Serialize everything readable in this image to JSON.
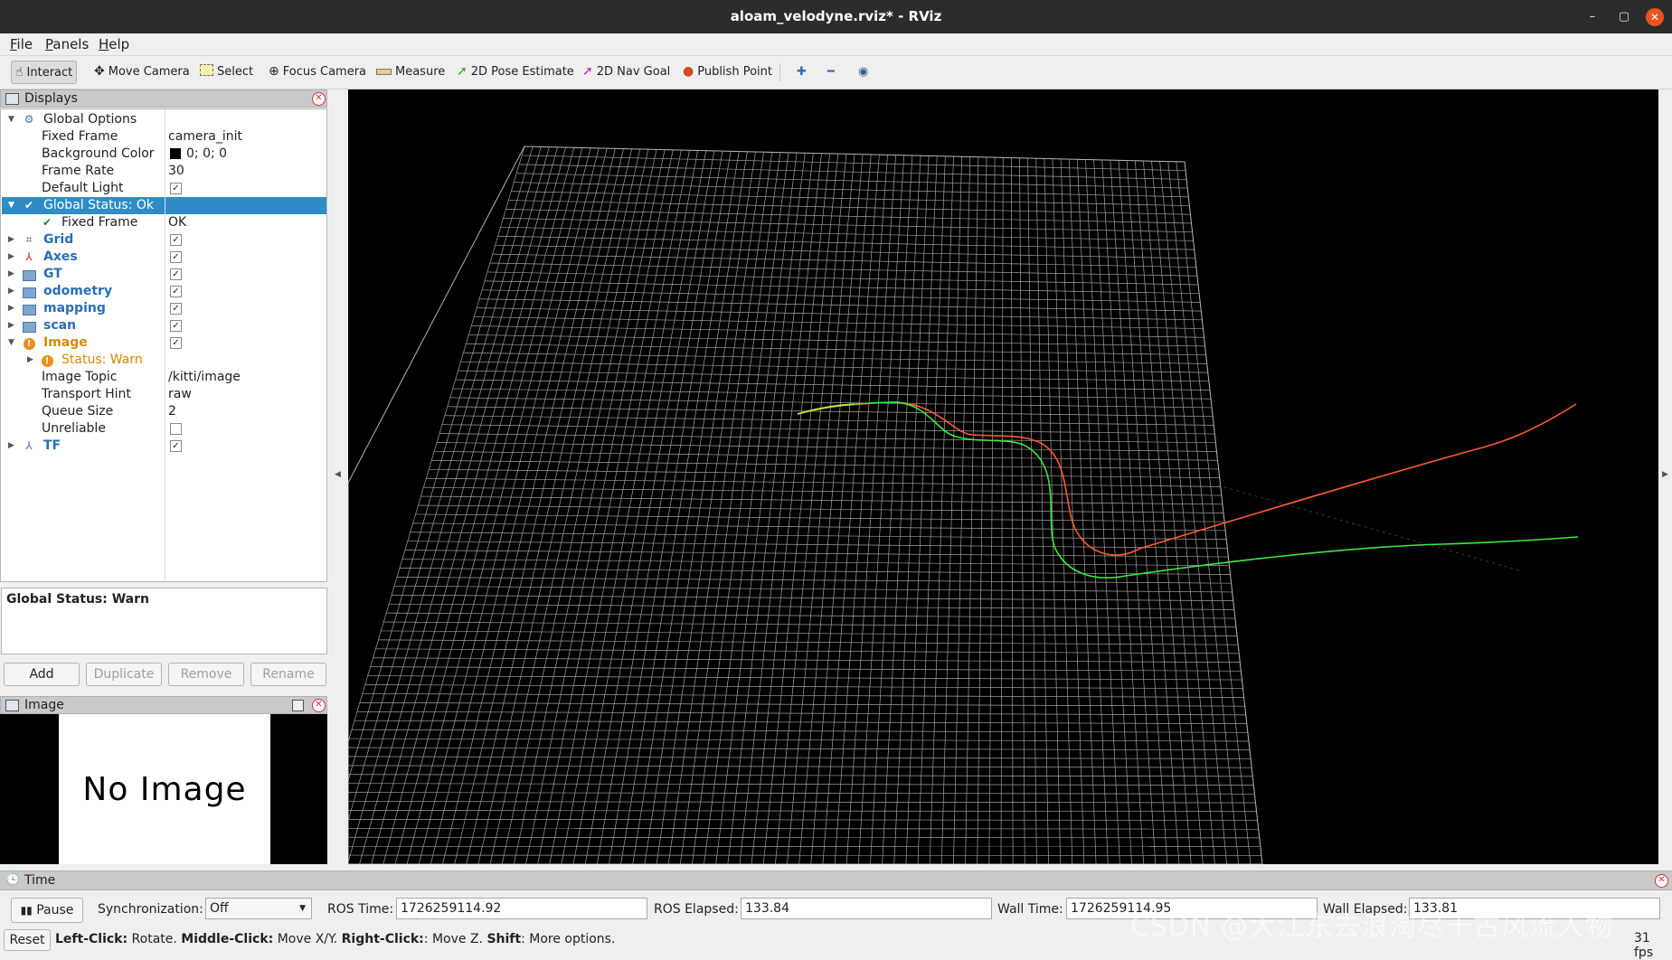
{
  "window": {
    "title": "aloam_velodyne.rviz* - RViz",
    "minimize_glyph": "–",
    "maximize_glyph": "▢",
    "close_glyph": "✕"
  },
  "menu": {
    "items": [
      {
        "first": "F",
        "rest": "ile"
      },
      {
        "first": "P",
        "rest": "anels"
      },
      {
        "first": "H",
        "rest": "elp"
      }
    ]
  },
  "toolbar": {
    "tools": [
      {
        "label": "Interact",
        "icon": "cursor-icon"
      },
      {
        "label": "Move Camera",
        "icon": "move-icon"
      },
      {
        "label": "Select",
        "icon": "select-icon"
      },
      {
        "label": "Focus Camera",
        "icon": "focus-icon"
      },
      {
        "label": "Measure",
        "icon": "ruler-icon"
      },
      {
        "label": "2D Pose Estimate",
        "icon": "green-arrow-icon"
      },
      {
        "label": "2D Nav Goal",
        "icon": "magenta-arrow-icon"
      },
      {
        "label": "Publish Point",
        "icon": "pin-icon"
      }
    ],
    "plus_glyph": "✚",
    "minus_glyph": "━",
    "eye_glyph": "◉"
  },
  "displays": {
    "title": "Displays",
    "rows": [
      {
        "label": "Global Options",
        "value": ""
      },
      {
        "label": "Fixed Frame",
        "value": "camera_init"
      },
      {
        "label": "Background Color",
        "value": "0; 0; 0"
      },
      {
        "label": "Frame Rate",
        "value": "30"
      },
      {
        "label": "Default Light",
        "value": ""
      },
      {
        "label": "Global Status: Ok",
        "value": ""
      },
      {
        "label": "Fixed Frame",
        "value": "OK"
      },
      {
        "label": "Grid",
        "value": ""
      },
      {
        "label": "Axes",
        "value": ""
      },
      {
        "label": "GT",
        "value": ""
      },
      {
        "label": "odometry",
        "value": ""
      },
      {
        "label": "mapping",
        "value": ""
      },
      {
        "label": "scan",
        "value": ""
      },
      {
        "label": "Image",
        "value": ""
      },
      {
        "label": "Status: Warn",
        "value": ""
      },
      {
        "label": "Image Topic",
        "value": "/kitti/image"
      },
      {
        "label": "Transport Hint",
        "value": "raw"
      },
      {
        "label": "Queue Size",
        "value": "2"
      },
      {
        "label": "Unreliable",
        "value": ""
      },
      {
        "label": "TF",
        "value": ""
      }
    ],
    "check_glyph": "✓",
    "status_text": "Global Status: Warn",
    "buttons": {
      "add": "Add",
      "duplicate": "Duplicate",
      "remove": "Remove",
      "rename": "Rename"
    }
  },
  "image_panel": {
    "title": "Image",
    "placeholder": "No Image"
  },
  "time": {
    "title": "Time",
    "pause": "Pause",
    "sync_label": "Synchronization:",
    "sync_value": "Off",
    "ros_time_label": "ROS Time:",
    "ros_time": "1726259114.92",
    "ros_elapsed_label": "ROS Elapsed:",
    "ros_elapsed": "133.84",
    "wall_time_label": "Wall Time:",
    "wall_time": "1726259114.95",
    "wall_elapsed_label": "Wall Elapsed:",
    "wall_elapsed": "133.81"
  },
  "statusbar": {
    "reset": "Reset",
    "h1b": "Left-Click:",
    "h1": " Rotate. ",
    "h2b": "Middle-Click:",
    "h2": " Move X/Y. ",
    "h3b": "Right-Click:",
    "h3": ": Move Z. ",
    "h4b": "Shift",
    "h4": ": More options.",
    "fps": "31 fps"
  },
  "watermark": "CSDN @大江东去浪淘尽千古风流人物",
  "colors": {
    "selection": "#308cc6",
    "odometry_path": "#ff5a36",
    "gt_path": "#3ee83e",
    "grid": "#a0a0a0",
    "viewport_bg": "#000000"
  }
}
